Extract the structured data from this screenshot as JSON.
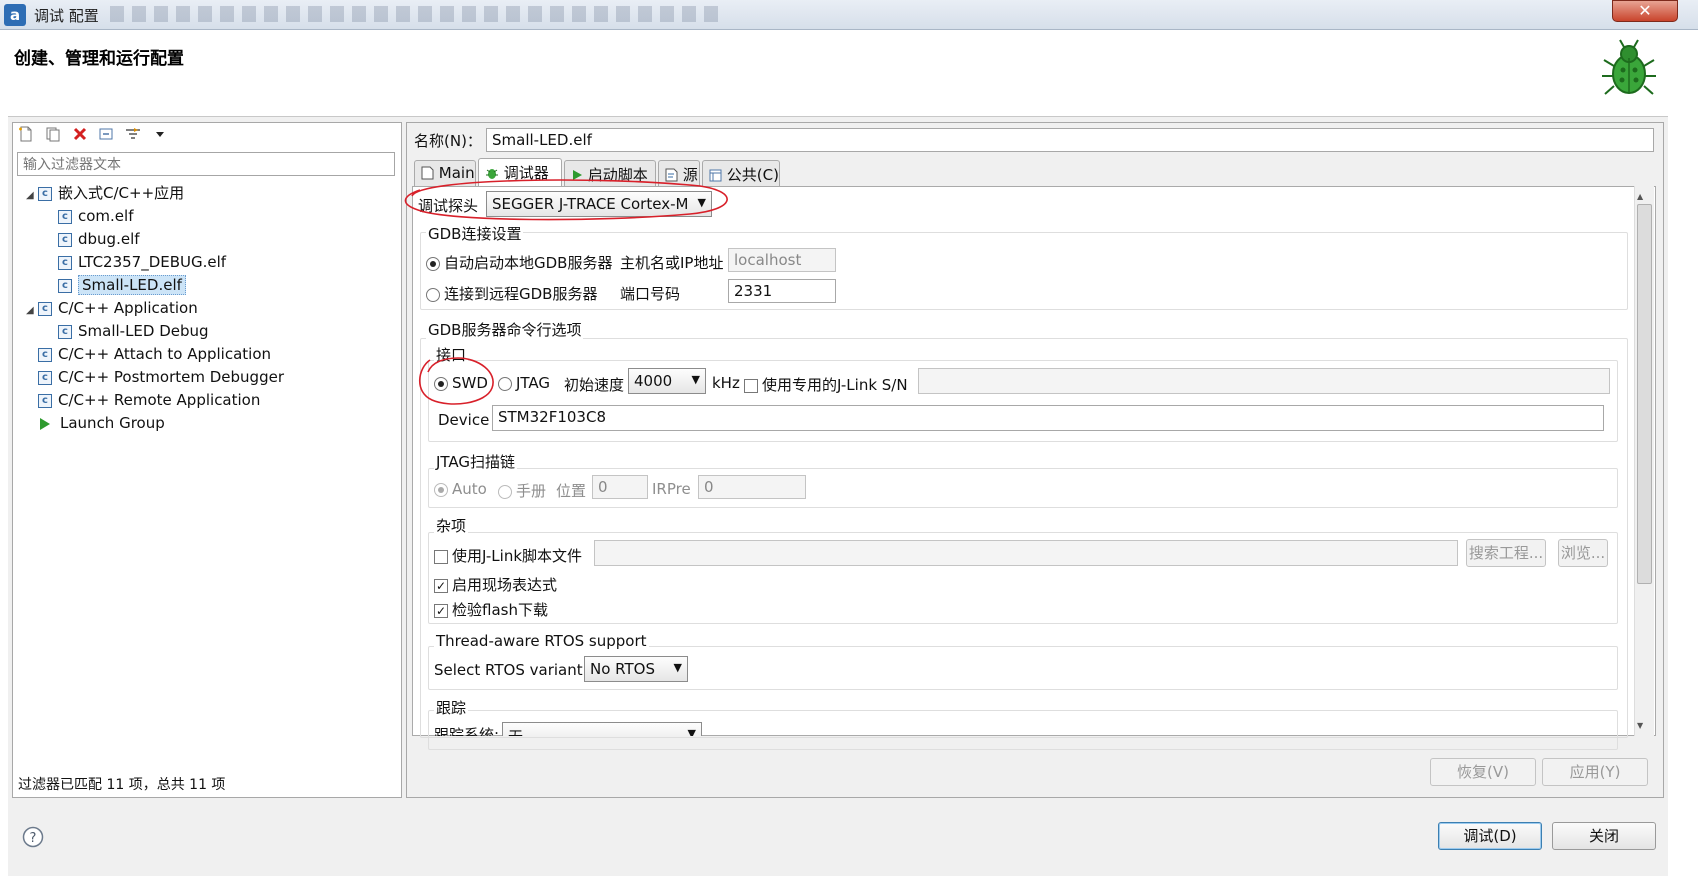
{
  "window": {
    "title": "调试 配置",
    "app_icon": "a",
    "close_label": "✕"
  },
  "header": {
    "title": "创建、管理和运行配置",
    "icon": "bug-icon"
  },
  "left": {
    "toolbar_icons": [
      "new-config-icon",
      "duplicate-icon",
      "delete-icon",
      "collapse-all-icon",
      "filter-icon",
      "dropdown-arrow-icon"
    ],
    "filter_placeholder": "输入过滤器文本",
    "tree": [
      {
        "label": "嵌入式C/C++应用",
        "level": 0,
        "expanded": true,
        "icon": "c-icon"
      },
      {
        "label": "com.elf",
        "level": 1,
        "icon": "c-icon"
      },
      {
        "label": "dbug.elf",
        "level": 1,
        "icon": "c-icon"
      },
      {
        "label": "LTC2357_DEBUG.elf",
        "level": 1,
        "icon": "c-icon"
      },
      {
        "label": "Small-LED.elf",
        "level": 1,
        "icon": "c-icon",
        "selected": true
      },
      {
        "label": "C/C++ Application",
        "level": 0,
        "expanded": true,
        "icon": "c-icon"
      },
      {
        "label": "Small-LED Debug",
        "level": 1,
        "icon": "c-icon"
      },
      {
        "label": "C/C++ Attach to Application",
        "level": 0,
        "icon": "c-icon"
      },
      {
        "label": "C/C++ Postmortem Debugger",
        "level": 0,
        "icon": "c-icon"
      },
      {
        "label": "C/C++ Remote Application",
        "level": 0,
        "icon": "c-icon"
      },
      {
        "label": "Launch Group",
        "level": 0,
        "icon": "launch-icon"
      }
    ],
    "status": "过滤器已匹配 11 项，总共 11 项"
  },
  "right": {
    "name_label": "名称(N)：",
    "name_value": "Small-LED.elf",
    "tabs": [
      {
        "label": "Main",
        "icon": "main-tab-icon"
      },
      {
        "label": "调试器",
        "icon": "debugger-icon",
        "active": true
      },
      {
        "label": "启动脚本",
        "icon": "startup-icon"
      },
      {
        "label": "源",
        "icon": "source-icon"
      },
      {
        "label": "公共(C)",
        "icon": "common-icon"
      }
    ],
    "probe_label": "调试探头",
    "probe_value": "SEGGER J-TRACE Cortex-M",
    "gdb_conn": {
      "title": "GDB连接设置",
      "auto_label": "自动启动本地GDB服务器",
      "remote_label": "连接到远程GDB服务器",
      "host_label": "主机名或IP地址",
      "host_value": "localhost",
      "port_label": "端口号码",
      "port_value": "2331"
    },
    "gdb_cmd_title": "GDB服务器命令行选项",
    "iface": {
      "title": "接口",
      "swd_label": "SWD",
      "jtag_label": "JTAG",
      "speed_label": "初始速度",
      "speed_value": "4000",
      "khz_label": "kHz",
      "sn_label": "使用专用的J-Link S/N",
      "sn_value": "",
      "device_label": "Device",
      "device_value": "STM32F103C8"
    },
    "jtag_chain": {
      "title": "JTAG扫描链",
      "auto_label": "Auto",
      "manual_label": "手册",
      "pos_label": "位置",
      "pos_value": "0",
      "irpre_label": "IRPre",
      "irpre_value": "0"
    },
    "misc": {
      "title": "杂项",
      "script_label": "使用J-Link脚本文件",
      "script_value": "",
      "search_button": "搜索工程...",
      "browse_button": "浏览...",
      "live_expr_label": "启用现场表达式",
      "verify_flash_label": "检验flash下载"
    },
    "rtos": {
      "title": "Thread-aware RTOS support",
      "variant_label": "Select RTOS variant:",
      "variant_value": "No RTOS"
    },
    "trace": {
      "title": "跟踪",
      "system_label": "跟踪系统:",
      "system_value": "无"
    },
    "revert_button": "恢复(V)",
    "apply_button": "应用(Y)"
  },
  "footer": {
    "help_icon": "help-icon",
    "debug_button": "调试(D)",
    "close_button": "关闭"
  },
  "colors": {
    "annotation": "#d8202a",
    "selection": "#cce4f7",
    "primary_border": "#3c7fb1"
  }
}
